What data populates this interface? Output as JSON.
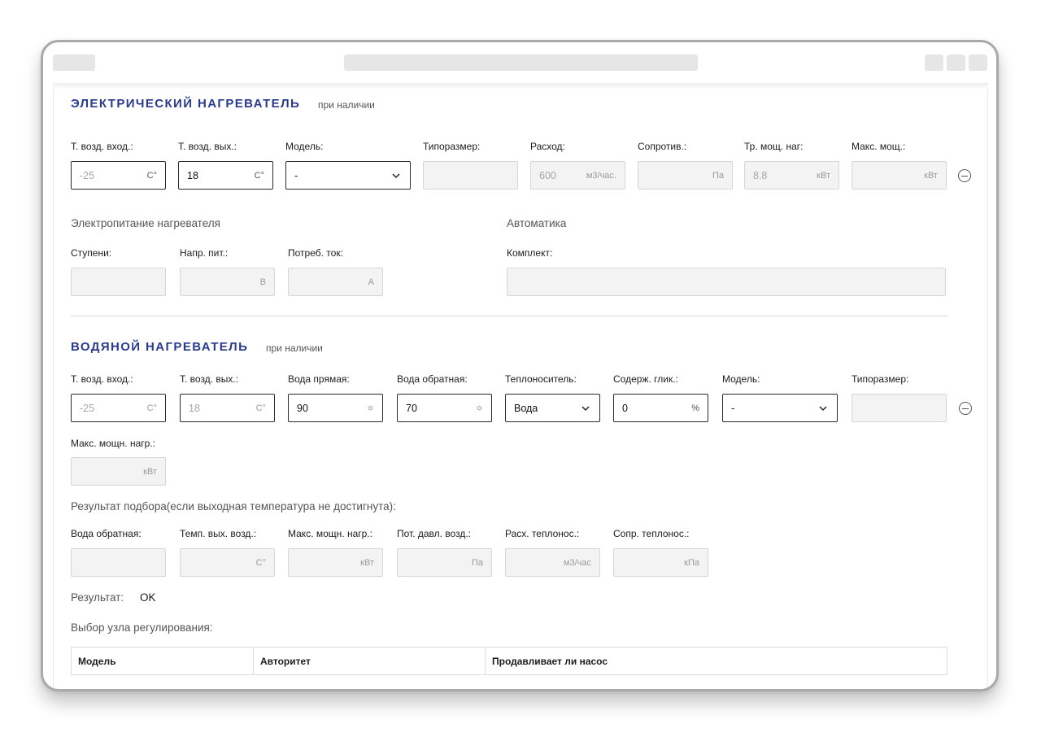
{
  "electric": {
    "title": "ЭЛЕКТРИЧЕСКИЙ НАГРЕВАТЕЛЬ",
    "note": "при наличии",
    "fields": {
      "t_in": {
        "label": "Т. возд. вход.:",
        "value": "-25",
        "unit": "С°"
      },
      "t_out": {
        "label": "Т. возд. вых.:",
        "value": "18",
        "unit": "С°"
      },
      "model": {
        "label": "Модель:",
        "value": "-"
      },
      "size": {
        "label": "Типоразмер:",
        "value": ""
      },
      "flow": {
        "label": "Расход:",
        "value": "600",
        "unit": "м3/час."
      },
      "resist": {
        "label": "Сопротив.:",
        "value": "",
        "unit": "Па"
      },
      "req_power": {
        "label": "Тр. мощ. наг:",
        "value": "8.8",
        "unit": "кВт"
      },
      "max_power": {
        "label": "Макс. мощ.:",
        "value": "",
        "unit": "кВт"
      }
    },
    "power_supply": {
      "title": "Электропитание нагревателя",
      "steps": {
        "label": "Ступени:",
        "value": ""
      },
      "voltage": {
        "label": "Напр. пит.:",
        "value": "",
        "unit": "В"
      },
      "current": {
        "label": "Потреб. ток:",
        "value": "",
        "unit": "А"
      }
    },
    "automation": {
      "title": "Автоматика",
      "kit": {
        "label": "Комплект:",
        "value": ""
      }
    }
  },
  "water": {
    "title": "ВОДЯНОЙ НАГРЕВАТЕЛЬ",
    "note": "при наличии",
    "fields": {
      "t_in": {
        "label": "Т. возд. вход.:",
        "value": "-25",
        "unit": "С°"
      },
      "t_out": {
        "label": "Т. возд. вых.:",
        "value": "18",
        "unit": "С°"
      },
      "water_supply": {
        "label": "Вода прямая:",
        "value": "90"
      },
      "water_return": {
        "label": "Вода обратная:",
        "value": "70"
      },
      "coolant": {
        "label": "Теплоноситель:",
        "value": "Вода"
      },
      "glycol": {
        "label": "Содерж. глик.:",
        "value": "0",
        "unit": "%"
      },
      "model": {
        "label": "Модель:",
        "value": "-"
      },
      "size": {
        "label": "Типоразмер:",
        "value": ""
      },
      "max_power": {
        "label": "Макс. мощн. нагр.:",
        "value": "",
        "unit": "кВт"
      }
    },
    "result_section": {
      "title": "Результат подбора(если выходная температура не достигнута):",
      "return_water": {
        "label": "Вода обратная:",
        "value": ""
      },
      "t_out_air": {
        "label": "Темп. вых. возд.:",
        "value": "",
        "unit": "С°"
      },
      "max_power": {
        "label": "Макс. мощн. нагр.:",
        "value": "",
        "unit": "кВт"
      },
      "pressure_loss": {
        "label": "Пот. давл. возд.:",
        "value": "",
        "unit": "Па"
      },
      "coolant_flow": {
        "label": "Расх. теплонос.:",
        "value": "",
        "unit": "м3/час"
      },
      "coolant_resist": {
        "label": "Сопр. теплонос.:",
        "value": "",
        "unit": "кПа"
      }
    },
    "result": {
      "label": "Результат:",
      "value": "OK"
    },
    "regulation": {
      "title": "Выбор узла регулирования:",
      "columns": [
        "Модель",
        "Авторитет",
        "Продавливает ли насос"
      ]
    }
  }
}
